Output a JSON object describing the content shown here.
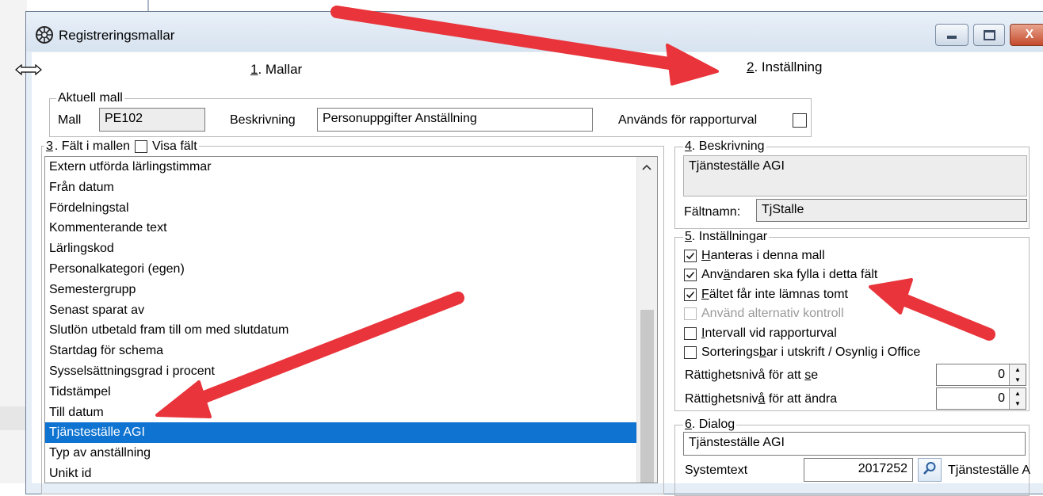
{
  "window": {
    "title": "Registreringsmallar"
  },
  "tabs": [
    {
      "prefix": "1",
      "label": ". Mallar"
    },
    {
      "prefix": "2",
      "label": ". Inställning"
    }
  ],
  "current_template": {
    "legend": "Aktuell mall",
    "mall_label": "Mall",
    "mall_value": "PE102",
    "desc_label": "Beskrivning",
    "desc_value": "Personuppgifter Anställning",
    "report_label": "Används för rapporturval",
    "report_checked": false
  },
  "fields": {
    "legend_prefix": "3",
    "legend_rest": ". Fält i mallen",
    "show_fields_label": "Visa fält",
    "items": [
      "Extern utförda lärlingstimmar",
      "Från datum",
      "Fördelningstal",
      "Kommenterande text",
      "Lärlingskod",
      "Personalkategori (egen)",
      "Semestergrupp",
      "Senast sparat av",
      "Slutlön utbetald fram till om med slutdatum",
      "Startdag för schema",
      "Sysselsättningsgrad i procent",
      "Tidstämpel",
      "Till datum",
      "Tjänsteställe AGI",
      "Typ av anställning",
      "Unikt id"
    ],
    "selected_index": 13
  },
  "description": {
    "legend_prefix": "4",
    "legend_rest": ". Beskrivning",
    "text": "Tjänsteställe AGI",
    "fieldname_label": "Fältnamn:",
    "fieldname_value": "TjStalle"
  },
  "settings": {
    "legend_prefix": "5",
    "legend_rest": ". Inställningar",
    "options": [
      {
        "pre": "",
        "key": "H",
        "post": "anteras i denna mall",
        "checked": true,
        "disabled": false
      },
      {
        "pre": "Anv",
        "key": "ä",
        "post": "ndaren ska fylla i detta fält",
        "checked": true,
        "disabled": false
      },
      {
        "pre": "",
        "key": "F",
        "post": "ältet får inte lämnas tomt",
        "checked": true,
        "disabled": false
      },
      {
        "pre": "",
        "key": "",
        "post": "Använd alternativ kontroll",
        "checked": false,
        "disabled": true
      },
      {
        "pre": "",
        "key": "I",
        "post": "ntervall vid rapporturval",
        "checked": false,
        "disabled": false
      },
      {
        "pre": "Sorterings",
        "key": "b",
        "post": "ar i utskrift / Osynlig i Office",
        "checked": false,
        "disabled": false
      }
    ],
    "rights_see": {
      "pre": "Rättighetsnivå för att ",
      "key": "s",
      "post": "e",
      "value": "0"
    },
    "rights_change": {
      "pre": "Rättighetsniv",
      "key": "å",
      "post": " för att ändra",
      "value": "0"
    }
  },
  "dialog": {
    "legend_prefix": "6",
    "legend_rest": ". Dialog",
    "text": "Tjänsteställe AGI",
    "systemtext_label": "Systemtext",
    "systemtext_value": "2017252",
    "systemtext_desc": "Tjänsteställe A"
  },
  "colors": {
    "selection": "#0f74d1",
    "annotation_arrow": "#e8343a",
    "close_button": "#c44a2c"
  },
  "icons": [
    "app-icon",
    "minimize-icon",
    "maximize-icon",
    "close-icon",
    "resize-cursor-icon",
    "scroll-up-icon",
    "search-icon",
    "spin-up-icon",
    "spin-down-icon",
    "checkmark-icon"
  ]
}
